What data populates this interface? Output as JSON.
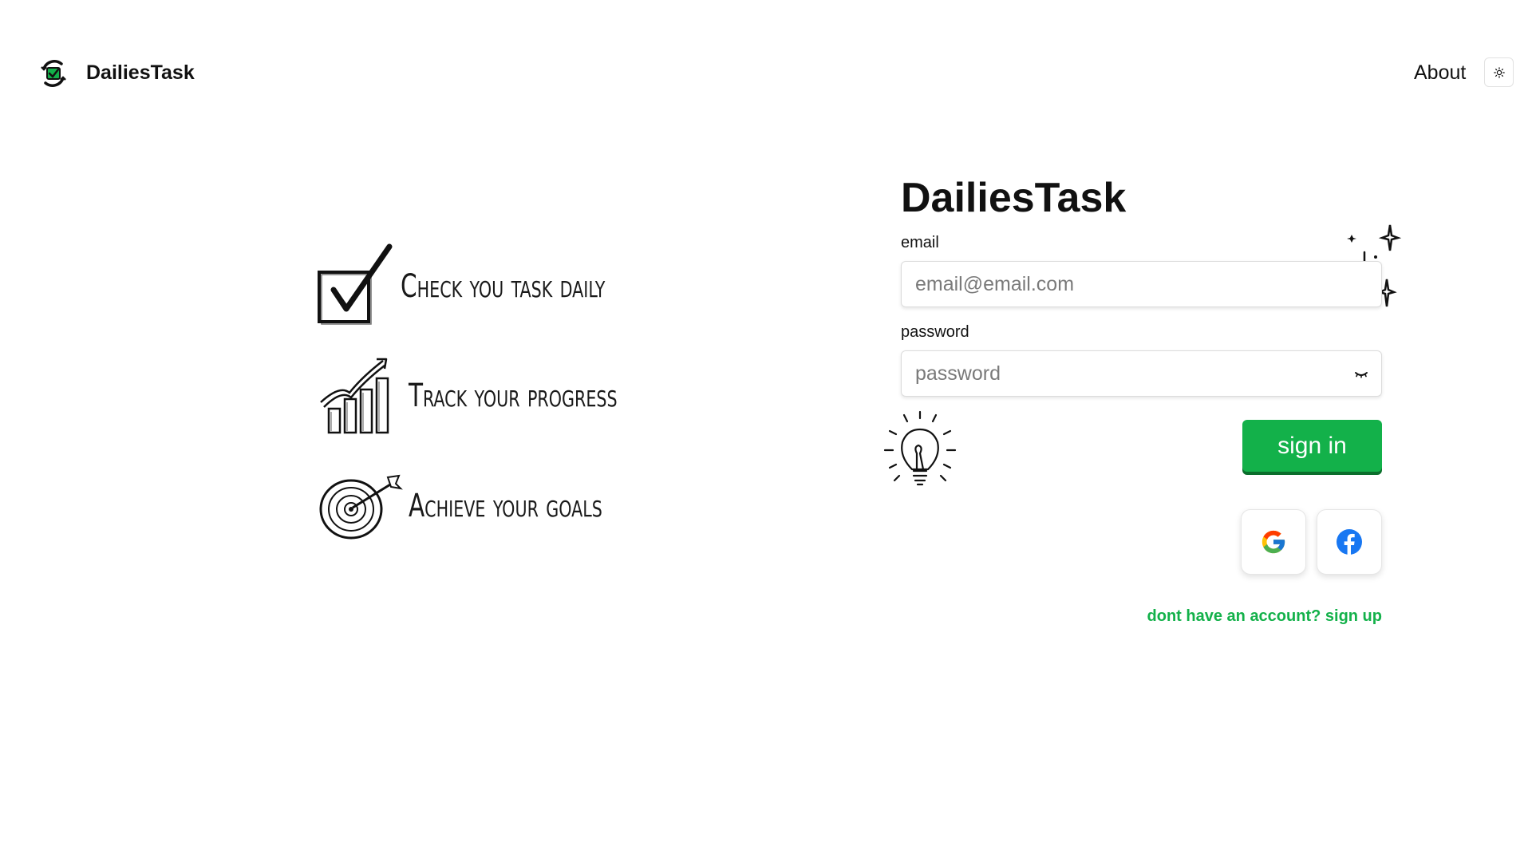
{
  "header": {
    "brand": "DailiesTask",
    "about_label": "About",
    "logo_icon": "checklist-logo-icon",
    "theme_icon": "sun-icon"
  },
  "features": [
    {
      "label": "Check you task daily",
      "icon": "checkbox-check-icon"
    },
    {
      "label": "Track your progress",
      "icon": "growth-chart-icon"
    },
    {
      "label": "Achieve your goals",
      "icon": "target-dart-icon"
    }
  ],
  "form": {
    "title": "DailiesTask",
    "email_label": "email",
    "email_placeholder": "email@email.com",
    "email_value": "",
    "password_label": "password",
    "password_placeholder": "password",
    "password_value": "",
    "password_toggle_icon": "eye-closed-icon",
    "signin_label": "sign in",
    "social": [
      {
        "name": "Google",
        "icon": "google-icon"
      },
      {
        "name": "Facebook",
        "icon": "facebook-icon"
      }
    ],
    "signup_text": "dont have an account? sign up"
  },
  "colors": {
    "accent": "#13b14a",
    "accent_shadow": "#0b6e2c",
    "facebook": "#1877f2"
  }
}
